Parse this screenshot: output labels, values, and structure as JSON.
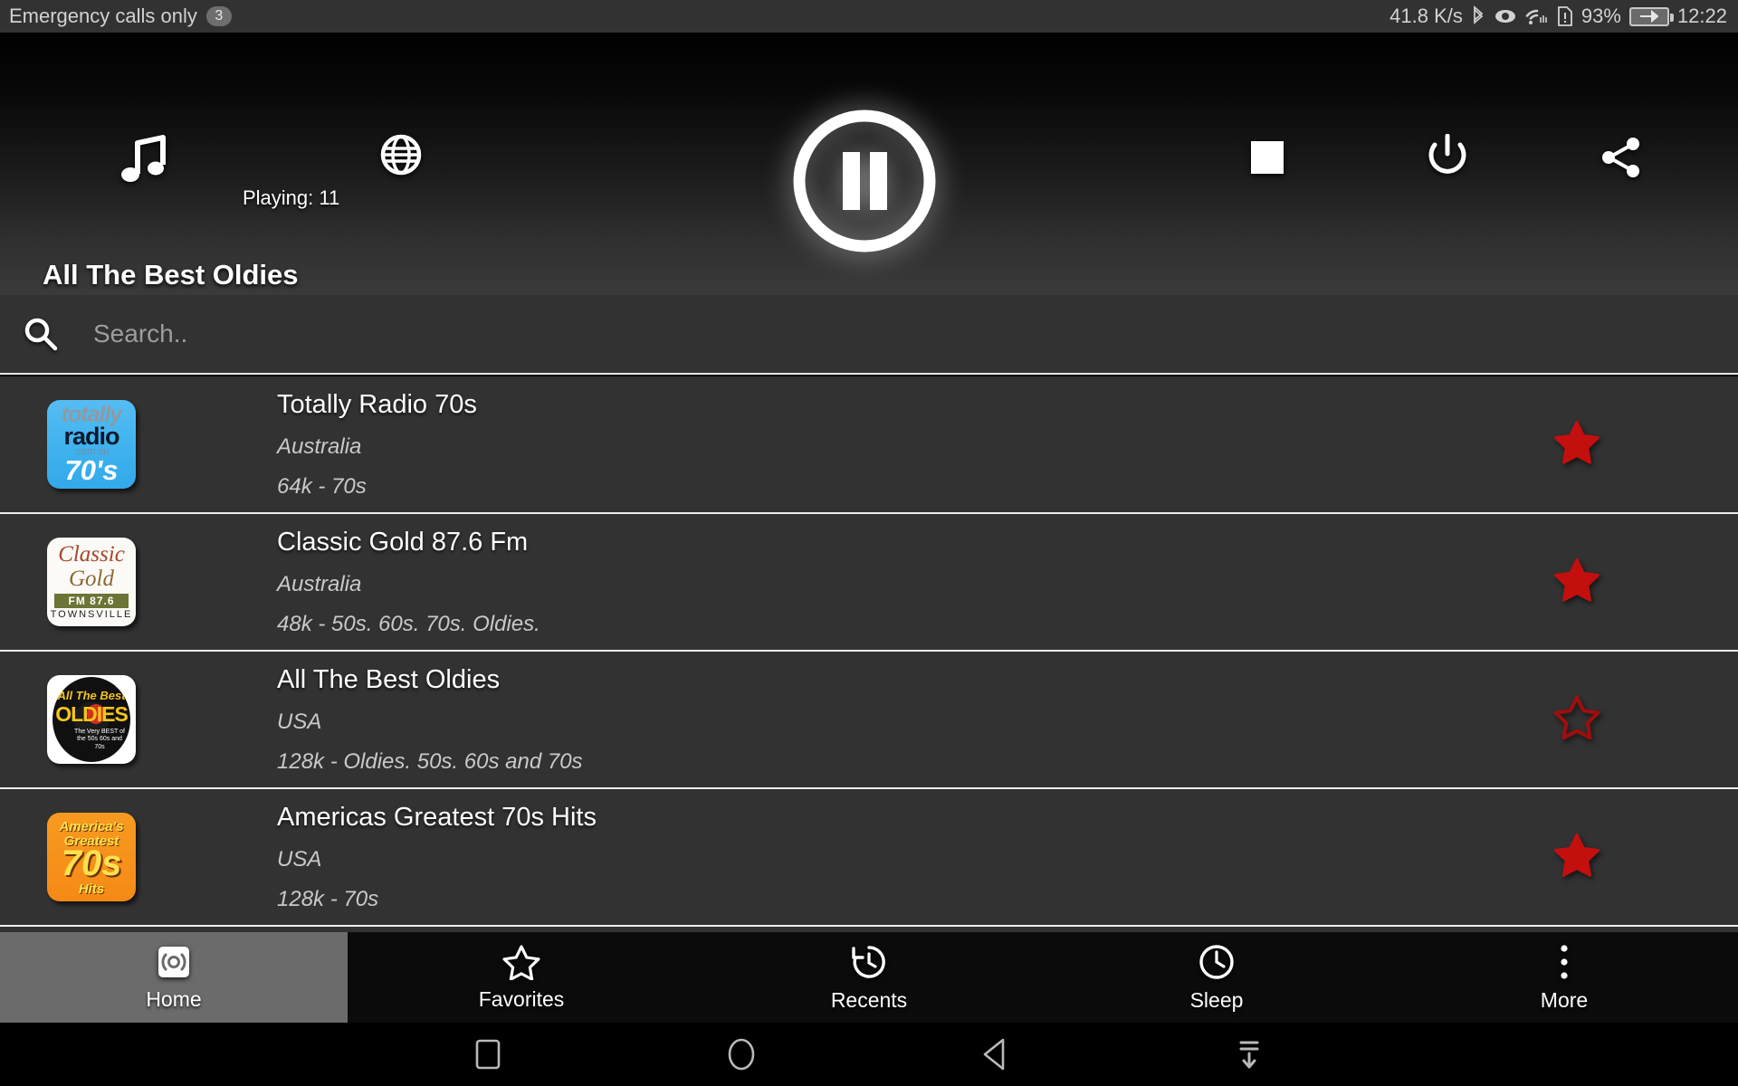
{
  "statusbar": {
    "carrier": "Emergency calls only",
    "notif_count": "3",
    "network_speed": "41.8 K/s",
    "battery_pct": "93%",
    "time": "12:22",
    "icons": [
      "bluetooth-icon",
      "eye-icon",
      "wifi-icon",
      "sim-alert-icon",
      "battery-charging-icon"
    ]
  },
  "player": {
    "music_icon": "music-note-icon",
    "globe_icon": "globe-icon",
    "playing_label": "Playing: 11",
    "pause_icon": "pause-icon",
    "stop_icon": "stop-icon",
    "power_icon": "power-icon",
    "share_icon": "share-icon",
    "now_playing_title": "All The Best Oldies"
  },
  "search": {
    "icon": "search-icon",
    "placeholder": "Search..",
    "value": ""
  },
  "stations": [
    {
      "name": "Totally Radio 70s",
      "country": "Australia",
      "info": "64k - 70s",
      "favorite": true,
      "logo": {
        "style": "lg-totally",
        "l1": "totally",
        "l2": "radio",
        "l3": ".com.au",
        "l4": "70's"
      }
    },
    {
      "name": "Classic Gold 87.6 Fm",
      "country": "Australia",
      "info": "48k - 50s. 60s. 70s. Oldies.",
      "favorite": true,
      "logo": {
        "style": "lg-classic",
        "l1": "Classic",
        "l2": "Gold",
        "l3": "FM 87.6",
        "l4": "TOWNSVILLE"
      }
    },
    {
      "name": "All The Best Oldies",
      "country": "USA",
      "info": "128k - Oldies. 50s. 60s and 70s",
      "favorite": false,
      "logo": {
        "style": "lg-oldies",
        "l1": "All The Best",
        "l2": "OLDIES",
        "l3": "The Very BEST of the 50s 60s and 70s",
        "l4": ""
      }
    },
    {
      "name": "Americas Greatest 70s Hits",
      "country": "USA",
      "info": "128k - 70s",
      "favorite": true,
      "logo": {
        "style": "lg-amer",
        "l1": "America's Greatest",
        "l2": "70s",
        "l3": "Hits",
        "l4": ""
      }
    }
  ],
  "bottomnav": {
    "items": [
      {
        "label": "Home",
        "icon": "broadcast-icon",
        "active": true
      },
      {
        "label": "Favorites",
        "icon": "star-outline-icon",
        "active": false
      },
      {
        "label": "Recents",
        "icon": "history-icon",
        "active": false
      },
      {
        "label": "Sleep",
        "icon": "clock-icon",
        "active": false
      },
      {
        "label": "More",
        "icon": "more-vertical-icon",
        "active": false
      }
    ]
  },
  "androidnav": {
    "items": [
      "recents-square-icon",
      "home-circle-icon",
      "back-triangle-icon",
      "hide-keyboard-icon"
    ]
  },
  "colors": {
    "favorite_star": "#c40f0f",
    "list_bg": "#323232",
    "active_nav": "#6b6b6b"
  }
}
